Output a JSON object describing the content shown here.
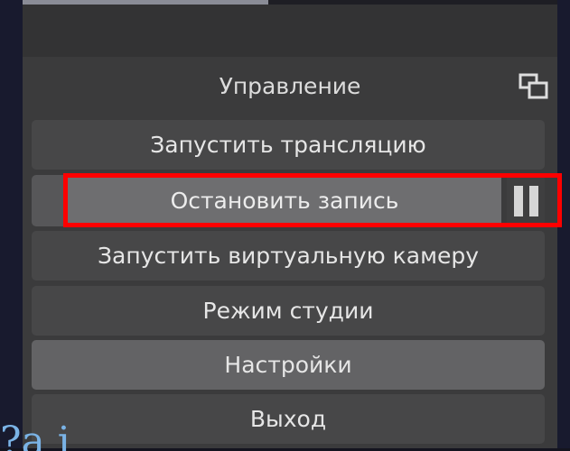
{
  "panel": {
    "title": "Управление",
    "float_icon": "undock-icon"
  },
  "controls": {
    "start_stream": "Запустить трансляцию",
    "stop_recording": "Остановить запись",
    "pause_icon": "pause-icon",
    "start_virtual_camera": "Запустить виртуальную камеру",
    "studio_mode": "Режим студии",
    "settings": "Настройки",
    "exit": "Выход"
  },
  "background": {
    "partial_text": "?a i"
  },
  "colors": {
    "highlight": "#ff0000",
    "dock_bg": "#3b3b3c",
    "button_bg": "#474748",
    "button_hover_bg": "#636365"
  }
}
